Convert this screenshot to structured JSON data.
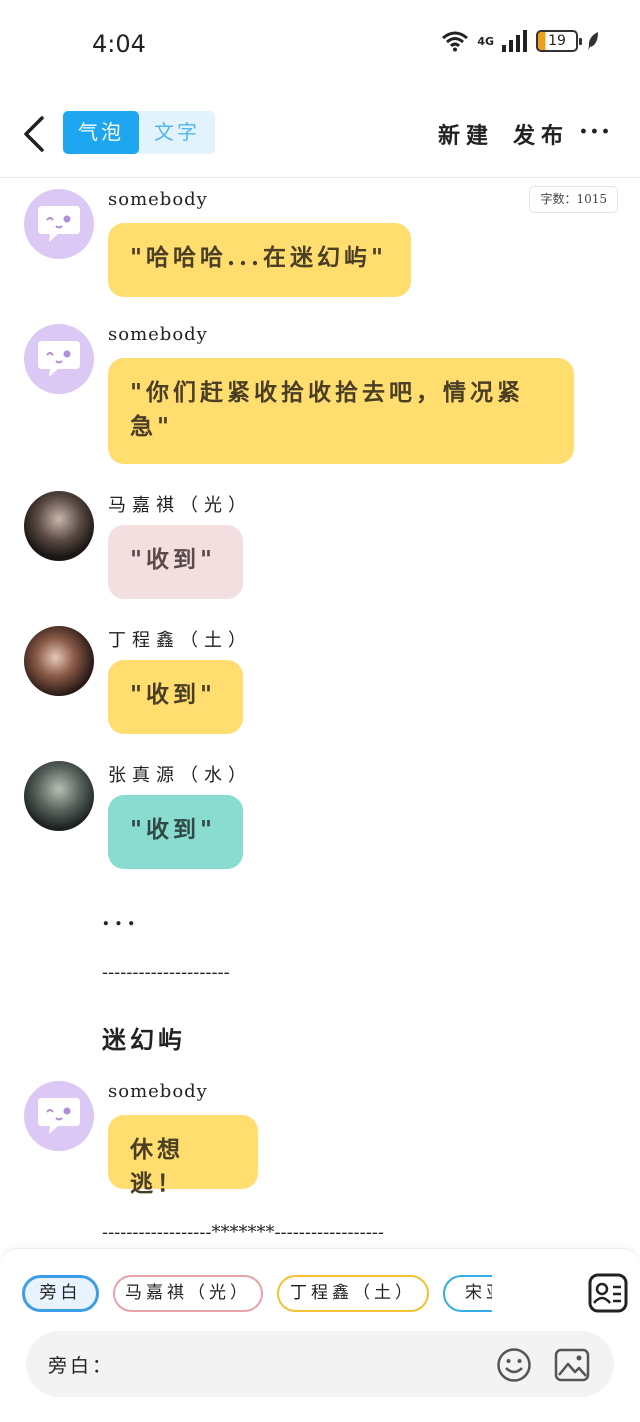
{
  "status_bar": {
    "time": "4:04",
    "network": "4G",
    "battery": "19"
  },
  "header": {
    "tabs": [
      {
        "label": "气泡",
        "active": true
      },
      {
        "label": "文字",
        "active": false
      }
    ],
    "new_label": "新建",
    "publish_label": "发布",
    "more_label": "···"
  },
  "word_count": "字数：1015",
  "messages": [
    {
      "name": "somebody",
      "text": "\"哈哈哈...在迷幻屿\"",
      "color": "#ffdd6f"
    },
    {
      "name": "somebody",
      "text": "\"你们赶紧收拾收拾去吧，情况紧急\"",
      "color": "#ffdd6f"
    },
    {
      "name": "马嘉祺（光）",
      "text": "\"收到\"",
      "color": "#f3dfe0"
    },
    {
      "name": "丁程鑫（土）",
      "text": "\"收到\"",
      "color": "#ffdd6f"
    },
    {
      "name": "张真源（水）",
      "text": "\"收到\"",
      "color": "#8adbd0"
    }
  ],
  "narration": {
    "ellipsis": "...",
    "dashes": "---------------------",
    "place": "迷幻屿"
  },
  "message_after": {
    "name": "somebody",
    "text": "休想逃！",
    "color": "#ffdd6f"
  },
  "separator": "------------------*******------------------",
  "bottom": {
    "chips": [
      "旁白",
      "马嘉祺（光）",
      "丁程鑫（土）",
      "宋亚"
    ],
    "input_label": "旁白：",
    "input_value": ""
  }
}
